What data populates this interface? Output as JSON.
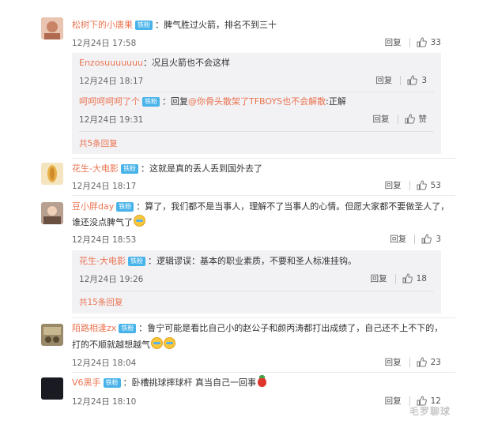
{
  "comments": [
    {
      "user": "松树下的小唐果",
      "badge": "铁粉",
      "text": "：脾气胜过火箭，排名不到三十",
      "time": "12月24日 17:58",
      "reply_label": "回复",
      "likes": "33",
      "avatar_color": "#d9a48a"
    },
    {
      "user": "花生-大电影",
      "badge": "铁粉",
      "text": "：这就是真的丢人丢到国外去了",
      "time": "12月24日 18:17",
      "reply_label": "回复",
      "likes": "53",
      "avatar_color": "#e8b04a"
    },
    {
      "user": "豆小胖day",
      "badge": "铁粉",
      "text": "：算了，我们都不是当事人，理解不了当事人的心情。但愿大家都不要做圣人了，",
      "text2": "谁还没点脾气了",
      "time": "12月24日 18:53",
      "reply_label": "回复",
      "likes": "3",
      "avatar_color": "#8a6d5a"
    },
    {
      "user": "陌路相逢zx",
      "badge": "铁粉",
      "text": "：鲁宁可能是看比自己小的赵公子和颜丙涛都打出成绩了，自己还不上不下的，",
      "text2": "打的不顺就越想越气",
      "time": "12月24日 18:04",
      "reply_label": "回复",
      "likes": "23",
      "avatar_color": "#7a6a4a"
    },
    {
      "user": "V6黑手",
      "badge": "铁粉",
      "text": "：卧槽挑球摔球杆 真当自己一回事",
      "time": "12月24日 18:10",
      "reply_label": "回复",
      "likes": "12",
      "avatar_color": "#1a1a22"
    }
  ],
  "replies_1": [
    {
      "user": "Enzosuuuuuuu",
      "text": "：况且火箭也不会这样",
      "time": "12月24日 18:17",
      "reply_label": "回复",
      "likes": "3"
    },
    {
      "user": "呵呵呵呵呵了个",
      "badge": "铁粉",
      "text_prefix": "：回复",
      "mention": "@你骨头散架了TFBOYS也不会解散",
      "text_suffix": ":正解",
      "time": "12月24日 19:31",
      "reply_label": "回复",
      "likes": "赞"
    }
  ],
  "more_1": "共5条回复",
  "replies_3": [
    {
      "user": "花生-大电影",
      "badge": "铁粉",
      "text": "：逻辑谬误：基本的职业素质，不要和圣人标准挂钩。",
      "time": "12月24日 19:26",
      "reply_label": "回复",
      "likes": "18"
    }
  ],
  "more_3": "共15条回复",
  "watermark": "毛罗聊球",
  "colors": {
    "username": "#eb7350",
    "badge": "#48b3e9",
    "subbox": "#f2f2f5"
  }
}
